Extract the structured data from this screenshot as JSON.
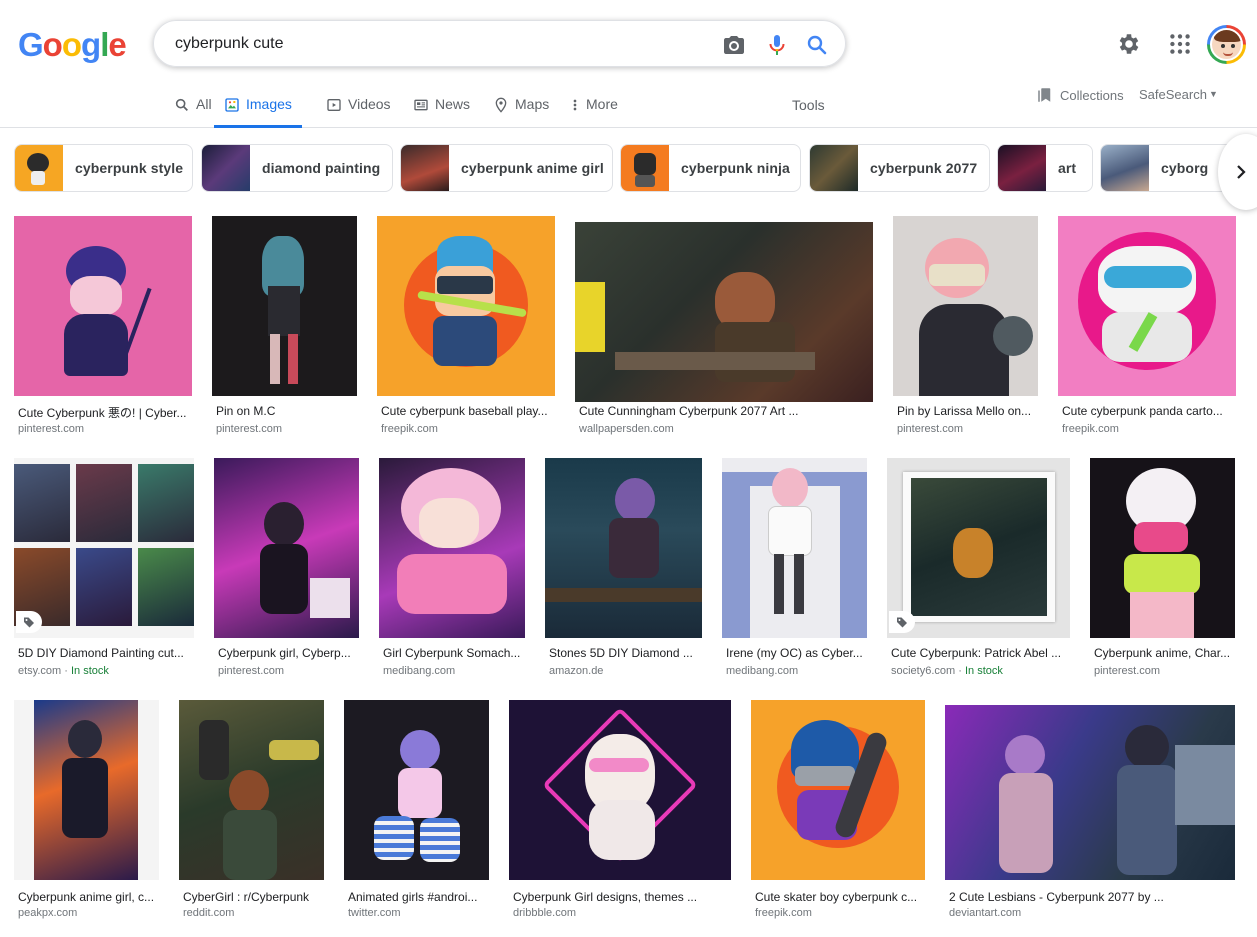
{
  "logo": "Google",
  "search": {
    "query": "cyberpunk cute"
  },
  "tabs": [
    {
      "label": "All",
      "icon": "search-icon"
    },
    {
      "label": "Images",
      "icon": "image-icon",
      "active": true
    },
    {
      "label": "Videos",
      "icon": "video-icon"
    },
    {
      "label": "News",
      "icon": "news-icon"
    },
    {
      "label": "Maps",
      "icon": "map-pin-icon"
    },
    {
      "label": "More",
      "icon": "more-vert-icon"
    }
  ],
  "tools": "Tools",
  "collections": "Collections",
  "safesearch": "SafeSearch",
  "chips": [
    "cyberpunk style",
    "diamond painting",
    "cyberpunk anime girl",
    "cyberpunk ninja",
    "cyberpunk 2077",
    "art",
    "cyborg"
  ],
  "results": [
    {
      "title": "Cute Cyberpunk 悪の! | Cyber...",
      "source": "pinterest.com"
    },
    {
      "title": "Pin on M.C",
      "source": "pinterest.com"
    },
    {
      "title": "Cute cyberpunk baseball play...",
      "source": "freepik.com"
    },
    {
      "title": "Cute Cunningham Cyberpunk 2077 Art ...",
      "source": "wallpapersden.com"
    },
    {
      "title": "Pin by Larissa Mello on...",
      "source": "pinterest.com"
    },
    {
      "title": "Cute cyberpunk panda carto...",
      "source": "freepik.com"
    },
    {
      "title": "5D DIY Diamond Painting cut...",
      "source": "etsy.com",
      "stock": "In stock"
    },
    {
      "title": "Cyberpunk girl, Cyberp...",
      "source": "pinterest.com"
    },
    {
      "title": "Girl Cyberpunk Somach...",
      "source": "medibang.com"
    },
    {
      "title": "Stones 5D DIY Diamond ...",
      "source": "amazon.de"
    },
    {
      "title": "Irene (my OC) as Cyber...",
      "source": "medibang.com"
    },
    {
      "title": "Cute Cyberpunk: Patrick Abel ...",
      "source": "society6.com",
      "stock": "In stock"
    },
    {
      "title": "Cyberpunk anime, Char...",
      "source": "pinterest.com"
    },
    {
      "title": "Cyberpunk anime girl, c...",
      "source": "peakpx.com"
    },
    {
      "title": "CyberGirl : r/Cyberpunk",
      "source": "reddit.com"
    },
    {
      "title": "Animated girls #androi...",
      "source": "twitter.com"
    },
    {
      "title": "Cyberpunk Girl designs, themes ...",
      "source": "dribbble.com"
    },
    {
      "title": "Cute skater boy cyberpunk c...",
      "source": "freepik.com"
    },
    {
      "title": "2 Cute Lesbians - Cyberpunk 2077 by ...",
      "source": "deviantart.com"
    }
  ]
}
